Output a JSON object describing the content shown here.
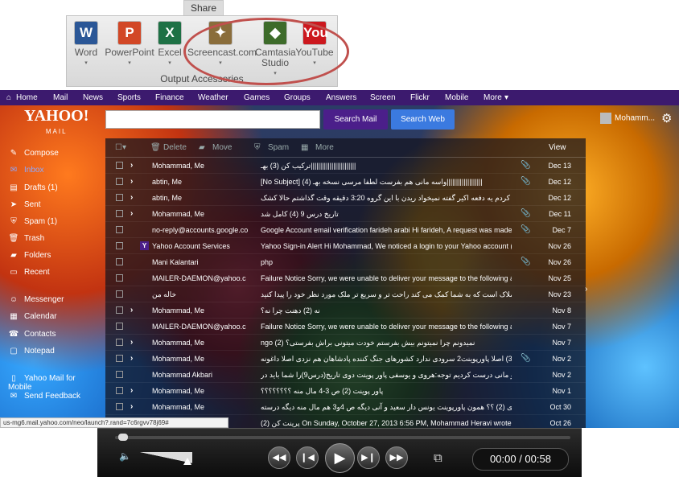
{
  "ribbon": {
    "tab": "Share",
    "group": "Output Accessories",
    "items": [
      {
        "label": "Word",
        "icon": "word-icon",
        "glyph": "W",
        "color": "#2b5797"
      },
      {
        "label": "PowerPoint",
        "icon": "powerpoint-icon",
        "glyph": "P",
        "color": "#d24726"
      },
      {
        "label": "Excel",
        "icon": "excel-icon",
        "glyph": "X",
        "color": "#1e7145"
      },
      {
        "label": "Screencast.com",
        "icon": "screencast-icon",
        "glyph": "✦",
        "color": "#8a6d3b"
      },
      {
        "label": "Camtasia",
        "label2": "Studio",
        "icon": "camtasia-icon",
        "glyph": "◆",
        "color": "#3d6b2a"
      },
      {
        "label": "YouTube",
        "icon": "youtube-icon",
        "glyph": "You",
        "color": "#cc181e"
      }
    ]
  },
  "nav": [
    "Home",
    "Mail",
    "News",
    "Sports",
    "Finance",
    "Weather",
    "Games",
    "Groups",
    "Answers",
    "Screen",
    "Flickr",
    "Mobile",
    "More"
  ],
  "logo": {
    "main": "YAHOO!",
    "sub": "MAIL"
  },
  "search": {
    "search_mail": "Search Mail",
    "search_web": "Search Web"
  },
  "user": "Mohamm...",
  "sidebar": [
    {
      "label": "Compose",
      "icon": "compose-icon",
      "glyph": "✎"
    },
    {
      "label": "Inbox",
      "icon": "inbox-icon",
      "glyph": "✉"
    },
    {
      "label": "Drafts (1)",
      "icon": "drafts-icon",
      "glyph": "▤"
    },
    {
      "label": "Sent",
      "icon": "sent-icon",
      "glyph": "➤"
    },
    {
      "label": "Spam (1)",
      "icon": "spam-icon",
      "glyph": "⛨"
    },
    {
      "label": "Trash",
      "icon": "trash-icon",
      "glyph": "🗑"
    },
    {
      "label": "Folders",
      "icon": "folders-icon",
      "glyph": "▰"
    },
    {
      "label": "Recent",
      "icon": "recent-icon",
      "glyph": "▭"
    },
    {
      "label": "Messenger",
      "icon": "messenger-icon",
      "glyph": "☺"
    },
    {
      "label": "Calendar",
      "icon": "calendar-icon",
      "glyph": "▦"
    },
    {
      "label": "Contacts",
      "icon": "contacts-icon",
      "glyph": "☎"
    },
    {
      "label": "Notepad",
      "icon": "notepad-icon",
      "glyph": "▢"
    },
    {
      "label": "Yahoo Mail for Mobile",
      "icon": "mobile-icon",
      "glyph": "▯"
    },
    {
      "label": "Send Feedback",
      "icon": "feedback-icon",
      "glyph": "✉"
    }
  ],
  "toolbar": {
    "delete": "Delete",
    "move": "Move",
    "spam": "Spam",
    "more": "More",
    "view": "View"
  },
  "emails": [
    {
      "from": "Mohammad, Me",
      "subject": "ترکیب کن  (3)  بهـ||||||||||||||||||||||||",
      "date": "Dec 13",
      "expand": true,
      "attach": true
    },
    {
      "from": "abtin, Me",
      "subject": "[No Subject]  (4)  واسه مانی هم بفرست لطفا مرسی نسخه بهـ|||||||||||||||||||",
      "date": "Dec 12",
      "expand": true,
      "attach": true
    },
    {
      "from": "abtin, Me",
      "subject": "الو  (2)  سلام؟ کلی درست کردم یه دفعه اکیر گفته نمیخواد ریدن با این گروه 3:20 دقیقه وقت گذاشتم حالا کشک",
      "date": "Dec 12",
      "expand": true,
      "attach": false
    },
    {
      "from": "Mohammad, Me",
      "subject": "تاریخ درس 9  (4)  کامل شد",
      "date": "Dec 11",
      "expand": true,
      "attach": true
    },
    {
      "from": "no-reply@accounts.google.co",
      "subject": "Google Account email verification   farideh arabi Hi farideh, A request was made to",
      "date": "Dec 7",
      "expand": false,
      "attach": true
    },
    {
      "from": "Yahoo Account Services",
      "subject": "Yahoo Sign-in Alert   Hi Mohammad, We noticed a login to your Yahoo account (h",
      "date": "Nov 26",
      "expand": false,
      "attach": false,
      "yahoo": true
    },
    {
      "from": "Mani Kalantari",
      "subject": "php",
      "date": "Nov 26",
      "expand": false,
      "attach": true
    },
    {
      "from": "MAILER-DAEMON@yahoo.c",
      "subject": "Failure Notice   Sorry, we were unable to deliver your message to the following adc",
      "date": "Nov 25",
      "expand": false,
      "attach": false
    },
    {
      "from": "خاله من",
      "subject": "تائید ایمیل   اطلاعات املاک است که به شما کمک می کند راحت تر و سریع تر ملک مورد نظر خود را پیدا کنید",
      "date": "Nov 23",
      "expand": false,
      "attach": false
    },
    {
      "from": "Mohammad, Me",
      "subject": "نه  (2)  دهنت چرا نه؟",
      "date": "Nov 8",
      "expand": true,
      "attach": false
    },
    {
      "from": "MAILER-DAEMON@yahoo.c",
      "subject": "Failure Notice   Sorry, we were unable to deliver your message to the following adc",
      "date": "Nov 7",
      "expand": false,
      "attach": false
    },
    {
      "from": "Mohammad, Me",
      "subject": "ngo  (2)  نمیدونم چرا نمیتونم بیش بفرستم خودت میتونی براش بفرستی؟",
      "date": "Nov 7",
      "expand": true,
      "attach": false
    },
    {
      "from": "Mohammad, Me",
      "subject": "تاریخ دومی  (3)  اصلا پاورپوینت2 سرودی ندارد کشورهای جنگ کننده پادشاهان هم نزدی اصلا داغونه",
      "date": "Nov 2",
      "expand": true,
      "attach": true
    },
    {
      "from": "Mohammad Akbari",
      "subject": "اولی تاریخ   که من و مانی درست کردیم توجه:هروی و یوسفی پاور پوینت دوی تاریخ(درس9)را شما باید در",
      "date": "Nov 2",
      "expand": false,
      "attach": false
    },
    {
      "from": "Mohammad, Me",
      "subject": "پاور پوینت  (2)  ص 3-4 مال منه ؟؟؟؟؟؟؟؟",
      "date": "Nov 1",
      "expand": true,
      "attach": false
    },
    {
      "from": "Mohammad, Me",
      "subject": "یاد آوری  (2)  ؟؟  همون پاورپوینت یونس دار سعید و آنی دیگه ص 4و3 هم مال منه دیگه درسته",
      "date": "Oct 30",
      "expand": true,
      "attach": false
    },
    {
      "from": "Mohammad, Me",
      "subject": "پرینت کن  (2)  On Sunday, October 27, 2013 6:56 PM, Mohammad Heravi wrote: On",
      "date": "Oct 26",
      "expand": true,
      "attach": false
    }
  ],
  "status_url": "us-mg6.mail.yahoo.com/neo/launch?.rand=7c6rgvv78j69#",
  "player": {
    "time": "00:00 / 00:58",
    "progress": 0,
    "volume": 0.85
  }
}
